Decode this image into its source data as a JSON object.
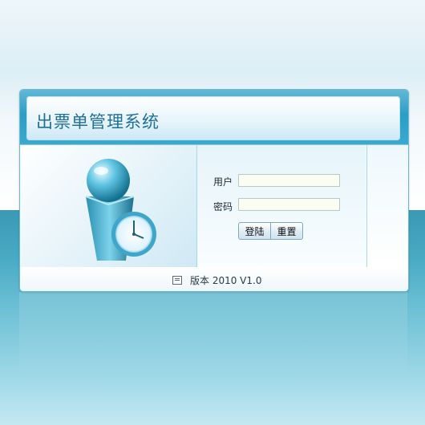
{
  "header": {
    "title": "出票单管理系统"
  },
  "login": {
    "username_label": "用户",
    "password_label": "密码",
    "username_value": "",
    "password_value": "",
    "login_button": "登陆",
    "reset_button": "重置"
  },
  "footer": {
    "version": "版本 2010 V1.0"
  },
  "colors": {
    "accent": "#2b9ec6",
    "bg_bottom": "#3a9ab6",
    "title": "#1f6f97"
  },
  "icons": {
    "illustration": "user-clock-icon",
    "version": "document-icon"
  }
}
